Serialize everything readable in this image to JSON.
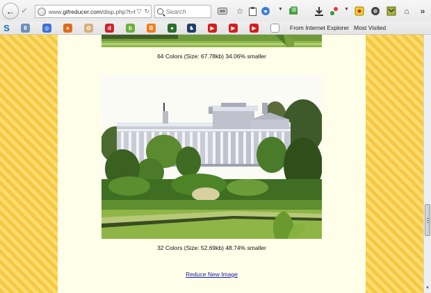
{
  "navbar": {
    "url_prefix": "www.",
    "url_domain": "gifreducer.com",
    "url_path": "/disp.php?t=hv",
    "search_placeholder": "Search"
  },
  "bookmarks": {
    "items": [
      {
        "icon": "s-logo-icon",
        "glyph": "S",
        "color": "#0d6fb5"
      },
      {
        "icon": "google-icon",
        "glyph": "8",
        "color": "#6f8fb7"
      },
      {
        "icon": "opera-icon",
        "glyph": "◎",
        "color": "#3d6fd0"
      },
      {
        "icon": "firefox-icon",
        "glyph": "●",
        "color": "#e06b1a"
      },
      {
        "icon": "paint-icon",
        "glyph": "✿",
        "color": "#d8b07a"
      },
      {
        "icon": "red-circle-icon",
        "glyph": "d",
        "color": "#c9252c"
      },
      {
        "icon": "blogger-green-icon",
        "glyph": "b",
        "color": "#6ab03c"
      },
      {
        "icon": "blogger-icon",
        "glyph": "B",
        "color": "#f07c18"
      },
      {
        "icon": "ball-icon",
        "glyph": "●",
        "color": "#2b6e2b"
      },
      {
        "icon": "bird-icon",
        "glyph": "♞",
        "color": "#1f3f66"
      },
      {
        "icon": "youtube-icon",
        "glyph": "▶",
        "color": "#d31f1f"
      },
      {
        "icon": "youtube-icon-2",
        "glyph": "▶",
        "color": "#d31f1f"
      },
      {
        "icon": "youtube-icon-3",
        "glyph": "▶",
        "color": "#d31f1f"
      },
      {
        "icon": "blank-page-icon",
        "glyph": "",
        "color": "#ffffff"
      }
    ],
    "from_ie_label": "From Internet Explorer",
    "most_visited_label": "Most Visited"
  },
  "page": {
    "caption_64": "64 Colors (Size: 67.78kb) 34.06% smaller",
    "caption_32": "32 Colors (Size: 52.69kb) 48.74% smaller",
    "reduce_link": "Reduce New Image"
  },
  "scroll": {
    "position": 0.79
  }
}
